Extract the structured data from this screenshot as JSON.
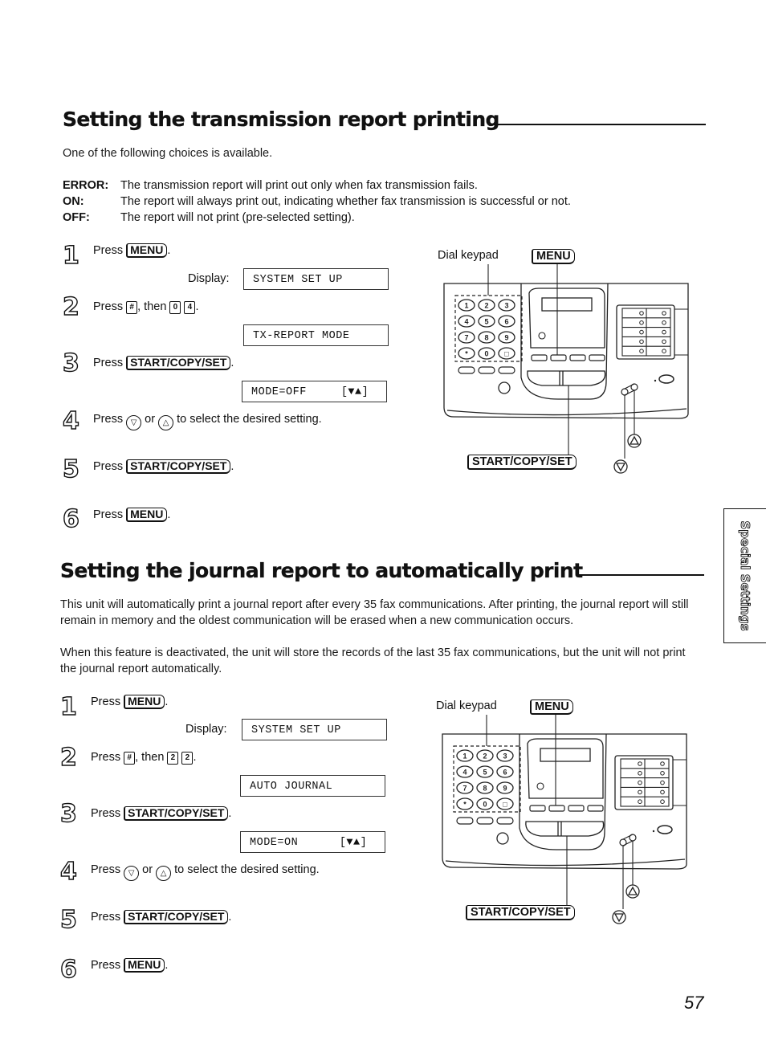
{
  "page_number": "57",
  "side_tab": "Special Settings",
  "section1": {
    "title": "Setting the transmission report printing",
    "intro": "One of the following choices is available.",
    "options": [
      {
        "term": "ERROR:",
        "desc": "The transmission report will print out only when fax transmission fails."
      },
      {
        "term": "ON:",
        "desc": "The report will always print out, indicating whether fax transmission is successful or not."
      },
      {
        "term": "OFF:",
        "desc": "The report will not print (pre-selected setting)."
      }
    ],
    "steps": [
      {
        "num": "1",
        "press": "Press",
        "key": "MENU",
        "display_label": "Display:",
        "display": "SYSTEM SET UP"
      },
      {
        "num": "2",
        "press": "Press",
        "key": "#",
        "then": ", then",
        "keys": [
          "0",
          "4"
        ],
        "display": "TX-REPORT MODE"
      },
      {
        "num": "3",
        "press": "Press",
        "key": "START/COPY/SET",
        "display": "MODE=OFF     [▼▲]"
      },
      {
        "num": "4",
        "press": "Press",
        "down": "▽",
        "or": "or",
        "up": "△",
        "rest": "to select the desired setting."
      },
      {
        "num": "5",
        "press": "Press",
        "key": "START/COPY/SET"
      },
      {
        "num": "6",
        "press": "Press",
        "key": "MENU"
      }
    ],
    "diagram": {
      "dial_keypad": "Dial keypad",
      "menu": "MENU",
      "start": "START/COPY/SET",
      "keypad_keys": [
        "1",
        "2",
        "3",
        "4",
        "5",
        "6",
        "7",
        "8",
        "9",
        "*",
        "0",
        "□"
      ]
    }
  },
  "section2": {
    "title": "Setting the journal report to automatically print",
    "para1": "This unit will automatically print a journal report after every 35 fax communications. After printing, the journal report will still remain in memory and the oldest communication will be erased when a new communication occurs.",
    "para2": "When this feature is deactivated, the unit will store the records of the last 35 fax communications, but the unit will not print the journal report automatically.",
    "steps": [
      {
        "num": "1",
        "press": "Press",
        "key": "MENU",
        "display_label": "Display:",
        "display": "SYSTEM SET UP"
      },
      {
        "num": "2",
        "press": "Press",
        "key": "#",
        "then": ", then",
        "keys": [
          "2",
          "2"
        ],
        "display": "AUTO JOURNAL"
      },
      {
        "num": "3",
        "press": "Press",
        "key": "START/COPY/SET",
        "display": "MODE=ON      [▼▲]"
      },
      {
        "num": "4",
        "press": "Press",
        "down": "▽",
        "or": "or",
        "up": "△",
        "rest": "to select the desired setting."
      },
      {
        "num": "5",
        "press": "Press",
        "key": "START/COPY/SET"
      },
      {
        "num": "6",
        "press": "Press",
        "key": "MENU"
      }
    ],
    "diagram": {
      "dial_keypad": "Dial keypad",
      "menu": "MENU",
      "start": "START/COPY/SET",
      "keypad_keys": [
        "1",
        "2",
        "3",
        "4",
        "5",
        "6",
        "7",
        "8",
        "9",
        "*",
        "0",
        "□"
      ]
    }
  }
}
